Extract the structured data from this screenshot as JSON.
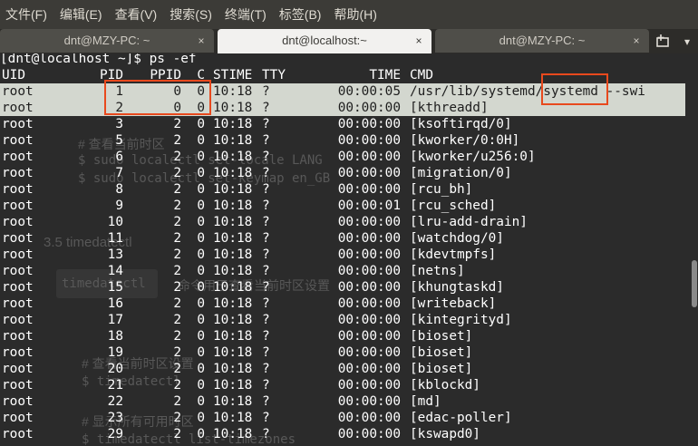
{
  "menu": [
    "文件(F)",
    "编辑(E)",
    "查看(V)",
    "搜索(S)",
    "终端(T)",
    "标签(B)",
    "帮助(H)"
  ],
  "tabs": [
    {
      "title": "dnt@MZY-PC: ~",
      "close": "×"
    },
    {
      "title": "dnt@localhost:~",
      "close": "×"
    },
    {
      "title": "dnt@MZY-PC: ~",
      "close": "×"
    }
  ],
  "tab_menu_glyph": "▾",
  "terminal": {
    "prompt": "[dnt@localhost ~]$ ps -ef",
    "headers": {
      "uid": "UID",
      "pid": "PID",
      "ppid": "PPID",
      "c": "C",
      "stime": "STIME",
      "tty": "TTY",
      "time": "TIME",
      "cmd": "CMD"
    },
    "rows": [
      {
        "uid": "root",
        "pid": "1",
        "ppid": "0",
        "c": "0",
        "stime": "10:18",
        "tty": "?",
        "time": "00:00:05",
        "cmd": "/usr/lib/systemd/systemd --swi"
      },
      {
        "uid": "root",
        "pid": "2",
        "ppid": "0",
        "c": "0",
        "stime": "10:18",
        "tty": "?",
        "time": "00:00:00",
        "cmd": "[kthreadd]"
      },
      {
        "uid": "root",
        "pid": "3",
        "ppid": "2",
        "c": "0",
        "stime": "10:18",
        "tty": "?",
        "time": "00:00:00",
        "cmd": "[ksoftirqd/0]"
      },
      {
        "uid": "root",
        "pid": "5",
        "ppid": "2",
        "c": "0",
        "stime": "10:18",
        "tty": "?",
        "time": "00:00:00",
        "cmd": "[kworker/0:0H]"
      },
      {
        "uid": "root",
        "pid": "6",
        "ppid": "2",
        "c": "0",
        "stime": "10:18",
        "tty": "?",
        "time": "00:00:00",
        "cmd": "[kworker/u256:0]"
      },
      {
        "uid": "root",
        "pid": "7",
        "ppid": "2",
        "c": "0",
        "stime": "10:18",
        "tty": "?",
        "time": "00:00:00",
        "cmd": "[migration/0]"
      },
      {
        "uid": "root",
        "pid": "8",
        "ppid": "2",
        "c": "0",
        "stime": "10:18",
        "tty": "?",
        "time": "00:00:00",
        "cmd": "[rcu_bh]"
      },
      {
        "uid": "root",
        "pid": "9",
        "ppid": "2",
        "c": "0",
        "stime": "10:18",
        "tty": "?",
        "time": "00:00:01",
        "cmd": "[rcu_sched]"
      },
      {
        "uid": "root",
        "pid": "10",
        "ppid": "2",
        "c": "0",
        "stime": "10:18",
        "tty": "?",
        "time": "00:00:00",
        "cmd": "[lru-add-drain]"
      },
      {
        "uid": "root",
        "pid": "11",
        "ppid": "2",
        "c": "0",
        "stime": "10:18",
        "tty": "?",
        "time": "00:00:00",
        "cmd": "[watchdog/0]"
      },
      {
        "uid": "root",
        "pid": "13",
        "ppid": "2",
        "c": "0",
        "stime": "10:18",
        "tty": "?",
        "time": "00:00:00",
        "cmd": "[kdevtmpfs]"
      },
      {
        "uid": "root",
        "pid": "14",
        "ppid": "2",
        "c": "0",
        "stime": "10:18",
        "tty": "?",
        "time": "00:00:00",
        "cmd": "[netns]"
      },
      {
        "uid": "root",
        "pid": "15",
        "ppid": "2",
        "c": "0",
        "stime": "10:18",
        "tty": "?",
        "time": "00:00:00",
        "cmd": "[khungtaskd]"
      },
      {
        "uid": "root",
        "pid": "16",
        "ppid": "2",
        "c": "0",
        "stime": "10:18",
        "tty": "?",
        "time": "00:00:00",
        "cmd": "[writeback]"
      },
      {
        "uid": "root",
        "pid": "17",
        "ppid": "2",
        "c": "0",
        "stime": "10:18",
        "tty": "?",
        "time": "00:00:00",
        "cmd": "[kintegrityd]"
      },
      {
        "uid": "root",
        "pid": "18",
        "ppid": "2",
        "c": "0",
        "stime": "10:18",
        "tty": "?",
        "time": "00:00:00",
        "cmd": "[bioset]"
      },
      {
        "uid": "root",
        "pid": "19",
        "ppid": "2",
        "c": "0",
        "stime": "10:18",
        "tty": "?",
        "time": "00:00:00",
        "cmd": "[bioset]"
      },
      {
        "uid": "root",
        "pid": "20",
        "ppid": "2",
        "c": "0",
        "stime": "10:18",
        "tty": "?",
        "time": "00:00:00",
        "cmd": "[bioset]"
      },
      {
        "uid": "root",
        "pid": "21",
        "ppid": "2",
        "c": "0",
        "stime": "10:18",
        "tty": "?",
        "time": "00:00:00",
        "cmd": "[kblockd]"
      },
      {
        "uid": "root",
        "pid": "22",
        "ppid": "2",
        "c": "0",
        "stime": "10:18",
        "tty": "?",
        "time": "00:00:00",
        "cmd": "[md]"
      },
      {
        "uid": "root",
        "pid": "23",
        "ppid": "2",
        "c": "0",
        "stime": "10:18",
        "tty": "?",
        "time": "00:00:00",
        "cmd": "[edac-poller]"
      },
      {
        "uid": "root",
        "pid": "29",
        "ppid": "2",
        "c": "0",
        "stime": "10:18",
        "tty": "?",
        "time": "00:00:00",
        "cmd": "[kswapd0]"
      }
    ]
  },
  "background_text": {
    "l1": "# 查看当前时区",
    "l2": "$ sudo localectl set-locale LANG",
    "l3": "$ sudo localectl set-keymap en_GB",
    "heading": "3.5 timedatectl",
    "code_tag": "timedatectl",
    "desc": "命令用于查看当前时区设置",
    "c1": "# 查看当前时区设置",
    "c2": "$ timedatectl",
    "c3": "# 显示所有可用时区",
    "c4": "$ timedatectl list-timezones"
  },
  "colors": {
    "menubar": "#3c3b37",
    "terminal_bg": "#2b2b2b",
    "highlight_row": "#d3d7cf",
    "annotation_red": "#e8491d"
  }
}
